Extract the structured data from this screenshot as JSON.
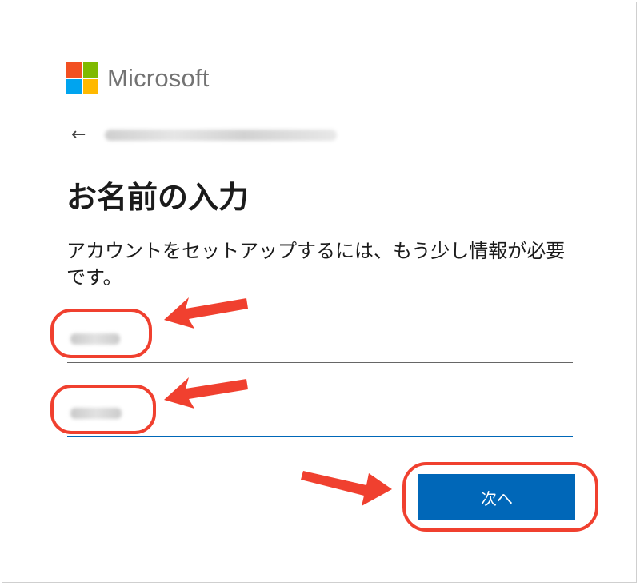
{
  "brand": {
    "name": "Microsoft",
    "logo_colors": [
      "#f25022",
      "#7fba00",
      "#00a4ef",
      "#ffb900"
    ]
  },
  "header": {
    "back_icon": "left-arrow-icon",
    "account_email": "(blurred email address)"
  },
  "title": "お名前の入力",
  "description": "アカウントをセットアップするには、もう少し情報が必要です。",
  "fields": {
    "last_name": {
      "value": "",
      "state": "blurred"
    },
    "first_name": {
      "value": "",
      "state": "blurred"
    }
  },
  "next_button_label": "次へ",
  "colors": {
    "accent": "#0067b8",
    "annotation": "#f0402f",
    "text": "#1b1b1b"
  }
}
